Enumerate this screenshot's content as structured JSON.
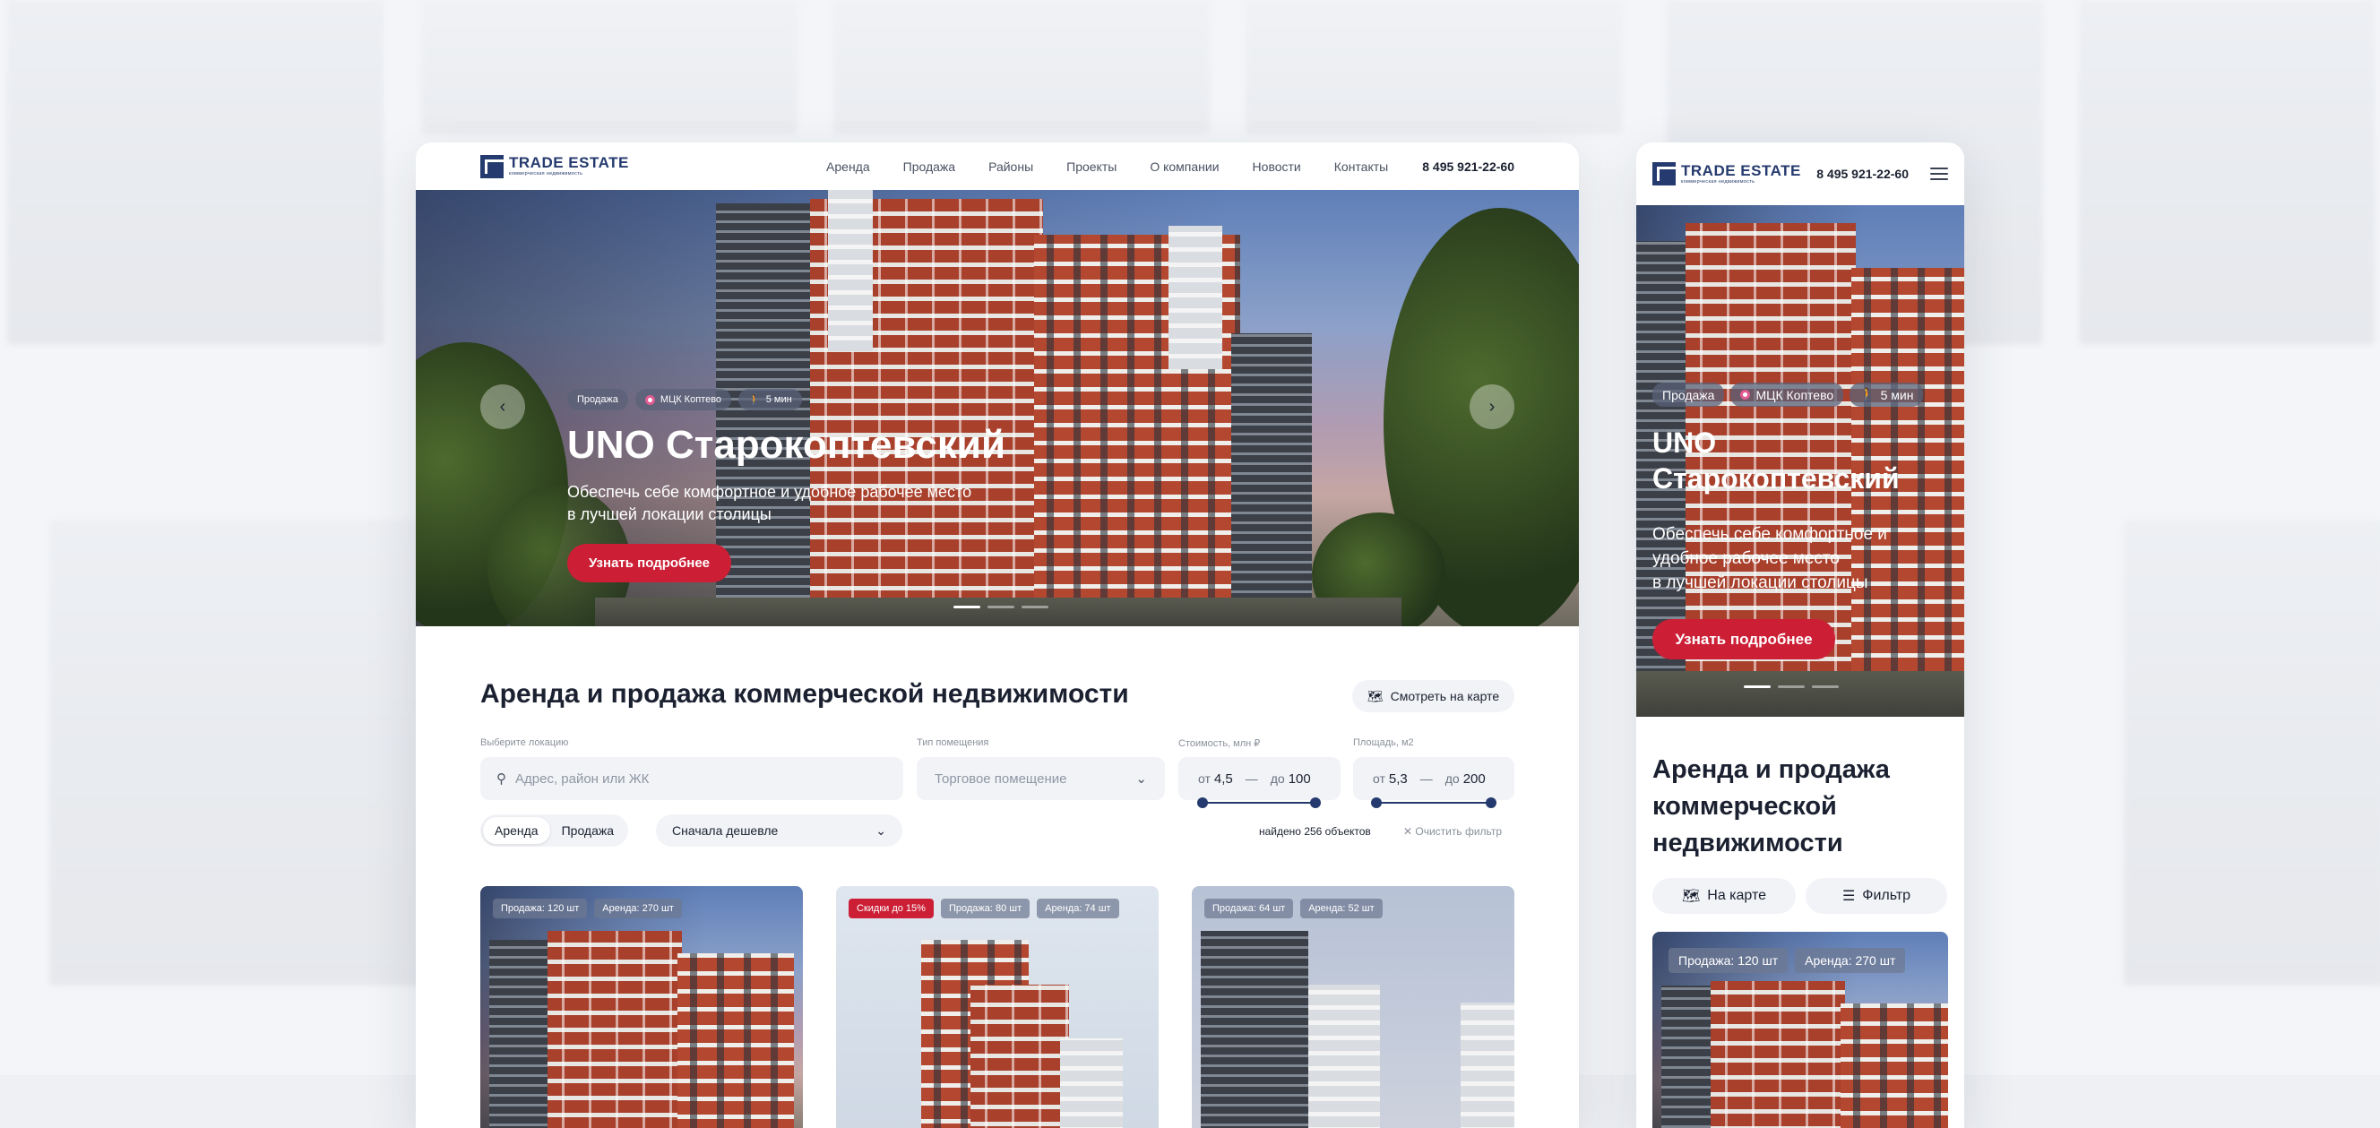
{
  "header": {
    "logo_name": "TRADE ESTATE",
    "logo_sub": "коммерческая недвижимость",
    "nav": [
      "Аренда",
      "Продажа",
      "Районы",
      "Проекты",
      "О компании",
      "Новости",
      "Контакты"
    ],
    "phone": "8 495 921-22-60"
  },
  "hero": {
    "chips": {
      "type": "Продажа",
      "station": "МЦК Коптево",
      "walk": "5 мин"
    },
    "title": "UNO Старокоптевский",
    "subtitle_line1": "Обеспечь себе комфортное и удобное рабочее место",
    "subtitle_line2": "в лучшей локации столицы",
    "mobile_subtitle_line1": "Обеспечь себе комфортное и",
    "mobile_subtitle_line2": "удобное рабочее место",
    "mobile_subtitle_line3": "в лучшей локации столицы",
    "cta": "Узнать подробнее",
    "prev_icon": "chevron-left-icon",
    "next_icon": "chevron-right-icon",
    "slides": 3,
    "active_slide": 1
  },
  "catalog": {
    "title": "Аренда и продажа коммерческой недвижимости",
    "mobile_title_line1": "Аренда и продажа",
    "mobile_title_line2": "коммерческой",
    "mobile_title_line3": "недвижимости",
    "map_button": "Смотреть на карте",
    "location": {
      "label": "Выберите локацию",
      "placeholder": "Адрес, район или ЖК"
    },
    "room_type": {
      "label": "Тип помещения",
      "value": "Торговое помещение"
    },
    "price": {
      "label": "Стоимость, млн ₽",
      "from_label": "от",
      "from": "4,5",
      "to_label": "до",
      "to": "100"
    },
    "area": {
      "label": "Площадь, м2",
      "from_label": "от",
      "from": "5,3",
      "to_label": "до",
      "to": "200"
    },
    "deal": {
      "rent": "Аренда",
      "sale": "Продажа",
      "active": "Аренда"
    },
    "sort": "Сначала дешевле",
    "found": "найдено 256 объектов",
    "clear": "Очистить фильтр",
    "mobile_map": "На карте",
    "mobile_filter": "Фильтр"
  },
  "cards": [
    {
      "tags": [
        "Продажа: 120 шт",
        "Аренда: 270 шт"
      ]
    },
    {
      "tags": [
        "Скидки до 15%",
        "Продажа: 80 шт",
        "Аренда: 74 шт"
      ],
      "discount_color": "#cc1f36"
    },
    {
      "tags": [
        "Продажа: 64 шт",
        "Аренда: 52 шт"
      ]
    }
  ],
  "colors": {
    "accent": "#cc1f36",
    "brand": "#253a6e"
  }
}
